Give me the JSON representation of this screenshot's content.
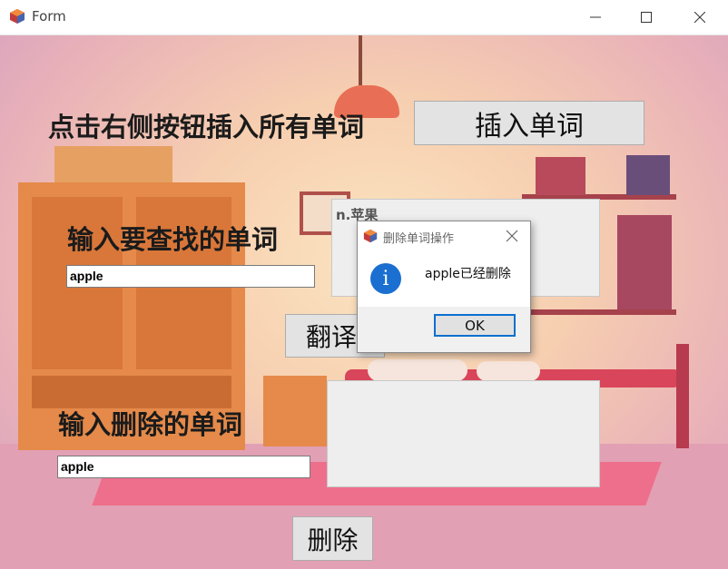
{
  "window": {
    "title": "Form",
    "controls": [
      "minimize-icon",
      "maximize-icon",
      "close-icon"
    ]
  },
  "insert_section": {
    "label": "点击右侧按钮插入所有单词",
    "button_label": "插入单词"
  },
  "search_section": {
    "label": "输入要查找的单词",
    "input_value": "apple",
    "result_text": "n.苹果",
    "button_label": "翻译"
  },
  "delete_section": {
    "label": "输入删除的单词",
    "input_value": "apple",
    "result_text": "",
    "button_label": "删除"
  },
  "dialog": {
    "title": "删除单词操作",
    "icon": "info-icon",
    "message": "apple已经删除",
    "ok_label": "OK"
  },
  "colors": {
    "dialog_accent": "#0a70d0",
    "info_icon": "#1a6fd0"
  }
}
